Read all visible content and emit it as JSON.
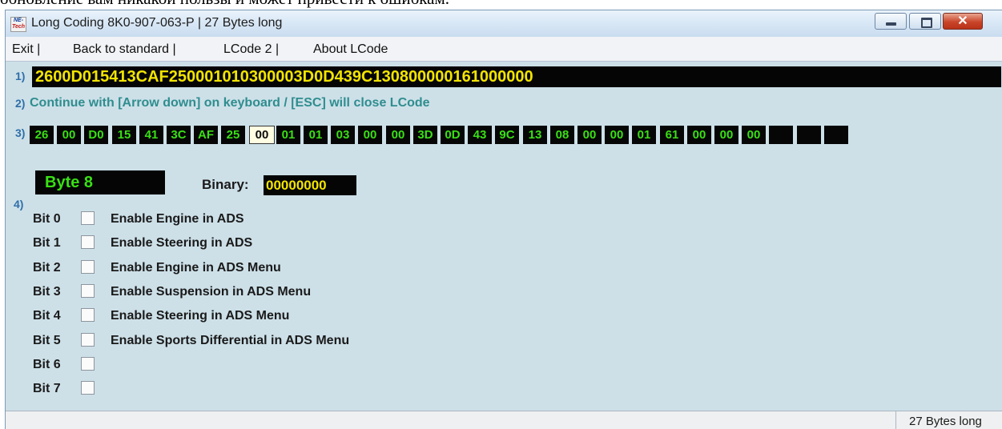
{
  "above_text": "обновление вам никакой пользы и может привести к ошибкам.",
  "window": {
    "title": "Long Coding  8K0-907-063-P | 27 Bytes long",
    "icon_lines": [
      "NE-",
      "Tech"
    ],
    "close_glyph": "✕"
  },
  "menu": [
    "Exit |",
    "Back to standard |",
    "LCode 2 |",
    "About LCode"
  ],
  "row_labels": [
    "1)",
    "2)",
    "3)",
    "4)"
  ],
  "coding_string": "2600D015413CAF250001010300003D0D439C130800000161000000",
  "hint": "Continue with [Arrow down] on keyboard / [ESC] will close LCode",
  "bytes": [
    "26",
    "00",
    "D0",
    "15",
    "41",
    "3C",
    "AF",
    "25",
    "00",
    "01",
    "01",
    "03",
    "00",
    "00",
    "3D",
    "0D",
    "43",
    "9C",
    "13",
    "08",
    "00",
    "00",
    "01",
    "61",
    "00",
    "00",
    "00",
    "",
    "",
    ""
  ],
  "selected_byte_index": 8,
  "byte_label": "Byte 8",
  "binary_label": "Binary:",
  "binary_value": "00000000",
  "bits": [
    {
      "label": "Bit 0",
      "desc": "Enable Engine in ADS",
      "checked": false
    },
    {
      "label": "Bit 1",
      "desc": "Enable Steering in ADS",
      "checked": false
    },
    {
      "label": "Bit 2",
      "desc": "Enable Engine in ADS Menu",
      "checked": false
    },
    {
      "label": "Bit 3",
      "desc": "Enable Suspension in ADS Menu",
      "checked": false
    },
    {
      "label": "Bit 4",
      "desc": "Enable Steering in ADS Menu",
      "checked": false
    },
    {
      "label": "Bit 5",
      "desc": "Enable Sports Differential in ADS Menu",
      "checked": false
    },
    {
      "label": "Bit 6",
      "desc": "",
      "checked": false
    },
    {
      "label": "Bit 7",
      "desc": "",
      "checked": false
    }
  ],
  "status": "27 Bytes long",
  "colors": {
    "window_bg": "#cde0e8",
    "yellow_text": "#f2e400",
    "green_text": "#39e014",
    "hint_text": "#2f8d8f",
    "label_blue": "#2f6fa8"
  }
}
